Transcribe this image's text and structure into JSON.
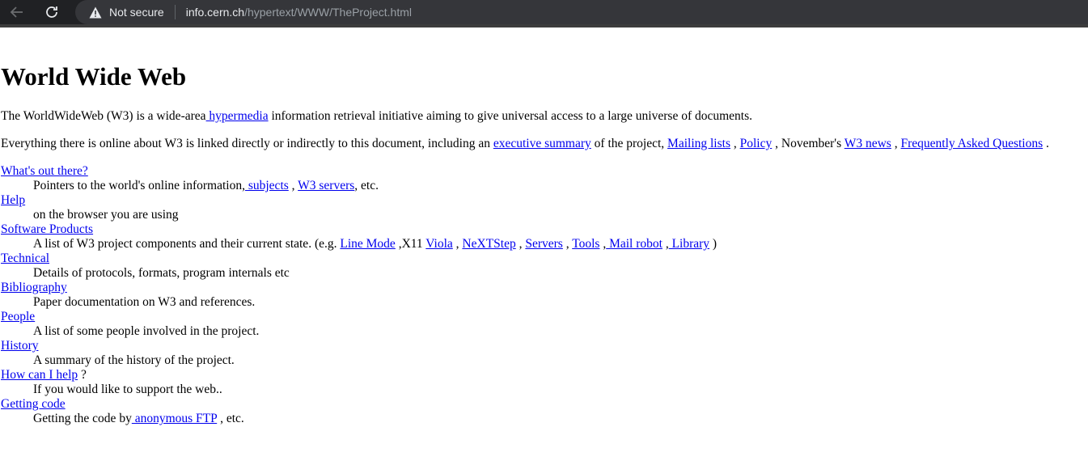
{
  "browser": {
    "security_label": "Not secure",
    "url_host": "info.cern.ch",
    "url_path": "/hypertext/WWW/TheProject.html"
  },
  "page": {
    "title": "World Wide Web",
    "intro": {
      "t1": "The WorldWideWeb (W3) is a wide-area",
      "link_hypermedia": " hypermedia",
      "t2": " information retrieval initiative aiming to give universal access to a large universe of documents."
    },
    "everything": {
      "t1": "Everything there is online about W3 is linked directly or indirectly to this document, including an ",
      "link_summary": "executive summary",
      "t2": " of the project, ",
      "link_mailing": "Mailing lists",
      "t3": " , ",
      "link_policy": "Policy",
      "t4": " , November's ",
      "link_news": "W3 news",
      "t5": " , ",
      "link_faq": "Frequently Asked Questions",
      "t6": " ."
    },
    "items": [
      {
        "term": "What's out there?",
        "desc1": "Pointers to the world's online information,",
        "link_subjects": " subjects",
        "desc2": " , ",
        "link_servers": "W3 servers",
        "desc3": ", etc."
      },
      {
        "term": "Help",
        "desc": "on the browser you are using"
      },
      {
        "term": "Software Products",
        "desc1": "A list of W3 project components and their current state. (e.g. ",
        "link_linemode": "Line Mode",
        "desc2": " ,X11 ",
        "link_viola": "Viola",
        "desc3": " , ",
        "link_nextstep": "NeXTStep",
        "desc4": " , ",
        "link_servers": "Servers",
        "desc5": " , ",
        "link_tools": "Tools",
        "desc6": " ,",
        "link_mailrobot": " Mail robot",
        "desc7": " ,",
        "link_library": " Library",
        "desc8": " )"
      },
      {
        "term": "Technical",
        "desc": "Details of protocols, formats, program internals etc"
      },
      {
        "term": "Bibliography",
        "desc": "Paper documentation on W3 and references."
      },
      {
        "term": "People",
        "desc": "A list of some people involved in the project."
      },
      {
        "term": "History",
        "desc": "A summary of the history of the project."
      },
      {
        "term": "How can I help",
        "term_suffix": " ?",
        "desc": "If you would like to support the web.."
      },
      {
        "term": "Getting code",
        "desc1": "Getting the code by",
        "link_ftp": " anonymous FTP",
        "desc2": " , etc."
      }
    ]
  }
}
